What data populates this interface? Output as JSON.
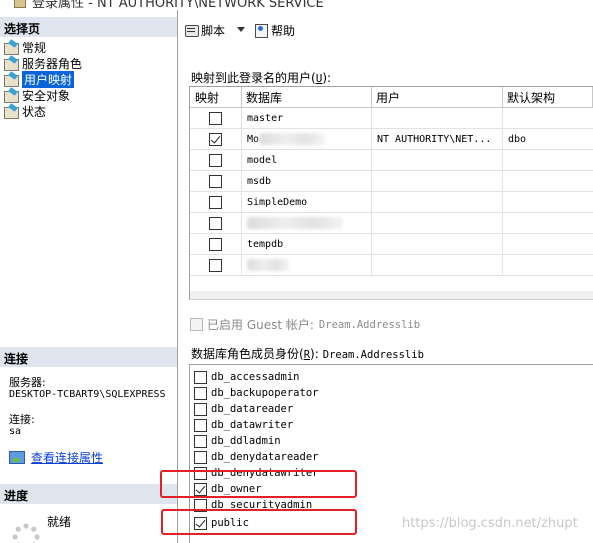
{
  "window": {
    "title": "登录属性 - NT AUTHORITY\\NETWORK SERVICE"
  },
  "left": {
    "select_page_header": "选择页",
    "pages": [
      {
        "label": "常规",
        "selected": false
      },
      {
        "label": "服务器角色",
        "selected": false
      },
      {
        "label": "用户映射",
        "selected": true
      },
      {
        "label": "安全对象",
        "selected": false
      },
      {
        "label": "状态",
        "selected": false
      }
    ],
    "connection_header": "连接",
    "server_label": "服务器:",
    "server_value": "DESKTOP-TCBART9\\SQLEXPRESS",
    "conn_label": "连接:",
    "conn_value": "sa",
    "view_conn_props": "查看连接属性",
    "progress_header": "进度",
    "progress_status": "就绪"
  },
  "toolbar": {
    "script_label": "脚本",
    "help_label": "帮助"
  },
  "mapping": {
    "label_prefix": "映射到此登录名的用户(",
    "label_key": "U",
    "label_suffix": "):",
    "headers": {
      "map": "映射",
      "database": "数据库",
      "user": "用户",
      "schema": "默认架构"
    },
    "rows": [
      {
        "checked": false,
        "database": "master",
        "user": "",
        "schema": ""
      },
      {
        "checked": true,
        "database": "Mo",
        "user": "NT AUTHORITY\\NET...",
        "schema": "dbo"
      },
      {
        "checked": false,
        "database": "model",
        "user": "",
        "schema": ""
      },
      {
        "checked": false,
        "database": "msdb",
        "user": "",
        "schema": ""
      },
      {
        "checked": false,
        "database": "SimpleDemo",
        "user": "",
        "schema": ""
      },
      {
        "checked": false,
        "database": "",
        "user": "",
        "schema": ""
      },
      {
        "checked": false,
        "database": "tempdb",
        "user": "",
        "schema": ""
      },
      {
        "checked": false,
        "database": "",
        "user": "",
        "schema": ""
      }
    ]
  },
  "guest": {
    "label_prefix": "已启用 Guest 帐户:",
    "db_name": "Dream.Addresslib"
  },
  "roles": {
    "label_prefix": "数据库角色成员身份(",
    "label_key": "R",
    "label_suffix": "):",
    "db_name": "Dream.Addresslib",
    "items": [
      {
        "name": "db_accessadmin",
        "checked": false
      },
      {
        "name": "db_backupoperator",
        "checked": false
      },
      {
        "name": "db_datareader",
        "checked": false
      },
      {
        "name": "db_datawriter",
        "checked": false
      },
      {
        "name": "db_ddladmin",
        "checked": false
      },
      {
        "name": "db_denydatareader",
        "checked": false
      },
      {
        "name": "db_denydatawriter",
        "checked": false
      },
      {
        "name": "db_owner",
        "checked": true
      },
      {
        "name": "db_securityadmin",
        "checked": false
      },
      {
        "name": "public",
        "checked": true
      }
    ]
  },
  "watermark": "https://blog.csdn.net/zhupt",
  "colors": {
    "selection": "#0a64d8",
    "section_header": "#dfe5ef",
    "highlight": "#e41f26",
    "link": "#0b3fd0"
  }
}
